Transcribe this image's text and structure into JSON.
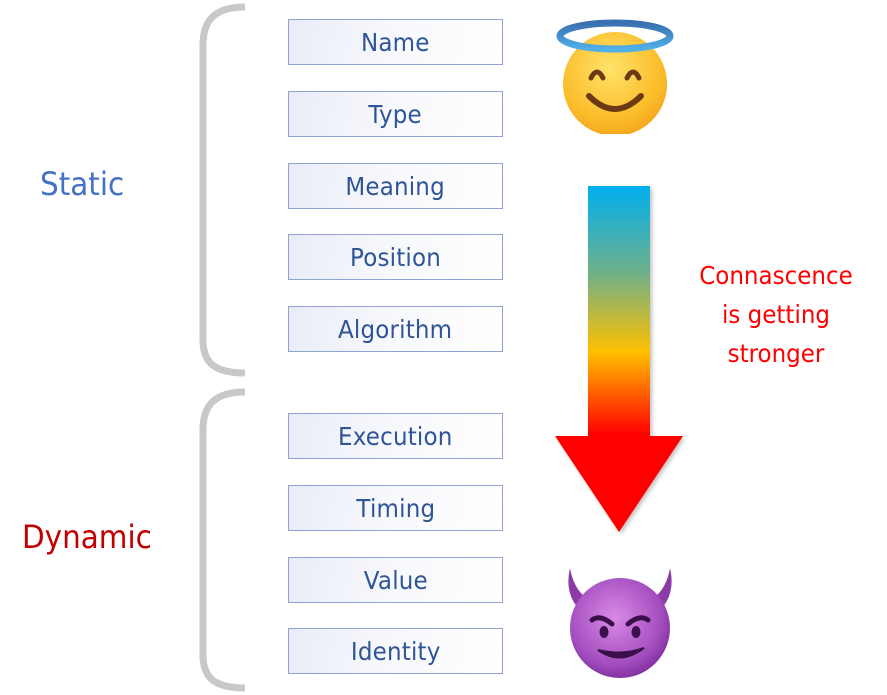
{
  "groups": {
    "static": {
      "label": "Static",
      "color": "#4472c4"
    },
    "dynamic": {
      "label": "Dynamic",
      "color": "#c00000"
    }
  },
  "static_items": [
    "Name",
    "Type",
    "Meaning",
    "Position",
    "Algorithm"
  ],
  "dynamic_items": [
    "Execution",
    "Timing",
    "Value",
    "Identity"
  ],
  "arrow": {
    "direction": "down",
    "gradient_colors": [
      "#00b0f0",
      "#8db56a",
      "#ffc000",
      "#ff0000"
    ]
  },
  "annotation": {
    "lines": [
      "Connascence",
      "is getting",
      "stronger"
    ],
    "color": "#ff0000"
  },
  "icons": {
    "top": "smiling-face-with-halo-icon",
    "bottom": "smiling-face-with-horns-icon"
  },
  "colors": {
    "box_text": "#2f5597",
    "box_border": "#8fa5cf",
    "brace": "#c8c8c8"
  }
}
